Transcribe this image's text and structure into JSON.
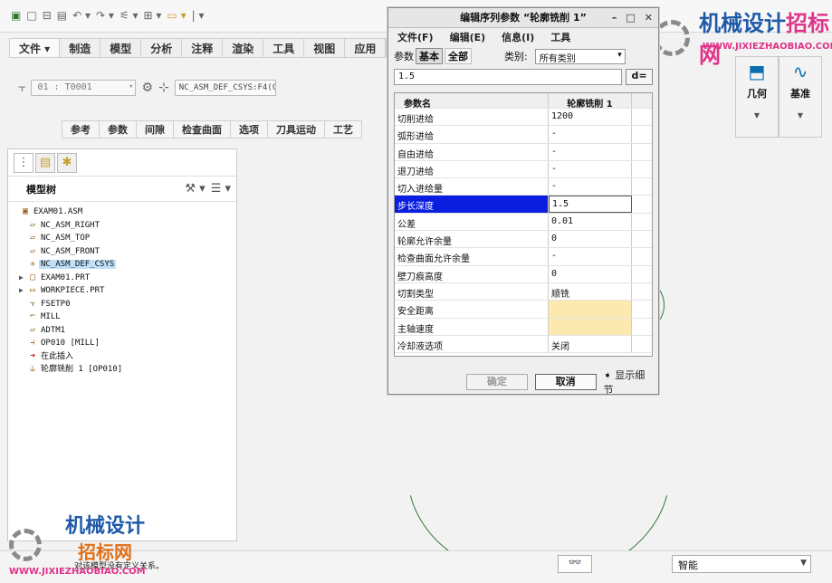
{
  "menubar": {
    "items": [
      "文件 ▾",
      "制造",
      "模型",
      "分析",
      "注释",
      "渲染",
      "工具",
      "视图",
      "应用"
    ]
  },
  "toolbar": {
    "tool_combo": "01 : T0001",
    "csys_field": "NC_ASM_DEF_CSYS:F4(C"
  },
  "subtabs": [
    "参考",
    "参数",
    "间隙",
    "检查曲面",
    "选项",
    "刀具运动",
    "工艺"
  ],
  "right_groups": [
    {
      "label": "几何"
    },
    {
      "label": "基准"
    }
  ],
  "model_tree": {
    "title": "模型树",
    "nodes": [
      {
        "label": "EXAM01.ASM",
        "indent": 0,
        "icon": "assembly-icon"
      },
      {
        "label": "NC_ASM_RIGHT",
        "indent": 1,
        "icon": "plane-icon"
      },
      {
        "label": "NC_ASM_TOP",
        "indent": 1,
        "icon": "plane-icon"
      },
      {
        "label": "NC_ASM_FRONT",
        "indent": 1,
        "icon": "plane-icon"
      },
      {
        "label": "NC_ASM_DEF_CSYS",
        "indent": 1,
        "icon": "csys-icon",
        "selected": true
      },
      {
        "label": "EXAM01.PRT",
        "indent": 1,
        "icon": "part-icon",
        "expandable": true
      },
      {
        "label": "WORKPIECE.PRT",
        "indent": 1,
        "icon": "workpiece-icon",
        "expandable": true
      },
      {
        "label": "FSETP0",
        "indent": 1,
        "icon": "fixture-icon"
      },
      {
        "label": "MILL",
        "indent": 1,
        "icon": "mill-icon"
      },
      {
        "label": "ADTM1",
        "indent": 1,
        "icon": "plane-icon"
      },
      {
        "label": "OP010 [MILL]",
        "indent": 1,
        "icon": "operation-icon"
      },
      {
        "label": "在此插入",
        "indent": 1,
        "icon": "insert-arrow-icon"
      },
      {
        "label": "轮廓铣削 1 [OP010]",
        "indent": 1,
        "icon": "profile-mill-icon"
      }
    ]
  },
  "dialog": {
    "title": "编辑序列参数 “轮廓铣削 1”",
    "menu": [
      "文件(F)",
      "编辑(E)",
      "信息(I)",
      "工具"
    ],
    "param_label": "参数",
    "basic_btn": "基本",
    "all_btn": "全部",
    "category_label": "类别:",
    "category_value": "所有类别",
    "input_value": "1.5",
    "d_btn": "d=",
    "table_head": {
      "name": "参数名",
      "value": "轮廓铣削 1"
    },
    "rows": [
      {
        "name": "切削进给",
        "value": "1200"
      },
      {
        "name": "弧形进给",
        "value": "-"
      },
      {
        "name": "自由进给",
        "value": "-"
      },
      {
        "name": "退刀进给",
        "value": "-"
      },
      {
        "name": "切入进给量",
        "value": "-"
      },
      {
        "name": "步长深度",
        "value": "1.5",
        "selected": true
      },
      {
        "name": "公差",
        "value": "0.01"
      },
      {
        "name": "轮廓允许余量",
        "value": "0"
      },
      {
        "name": "检查曲面允许余量",
        "value": "-"
      },
      {
        "name": "壁刀痕高度",
        "value": "0"
      },
      {
        "name": "切割类型",
        "value": "顺铣"
      },
      {
        "name": "安全距离",
        "value": "",
        "warn": true
      },
      {
        "name": "主轴速度",
        "value": "",
        "warn": true
      },
      {
        "name": "冷却液选项",
        "value": "关闭"
      }
    ],
    "ok_btn": "确定",
    "cancel_btn": "取消",
    "detail_btn": "显示细节"
  },
  "status": {
    "message": "对该模型没有定义关系。",
    "filter_value": "智能"
  },
  "watermark": {
    "top_cn_a": "机械设计",
    "top_cn_b": "招标网",
    "top_url": "WWW.JIXIEZHAOBIAO.COM",
    "bot_cn_a": "机械设计",
    "bot_cn_b": "招标网",
    "bot_url": "WWW.JIXIEZHAOBIAO.COM"
  }
}
